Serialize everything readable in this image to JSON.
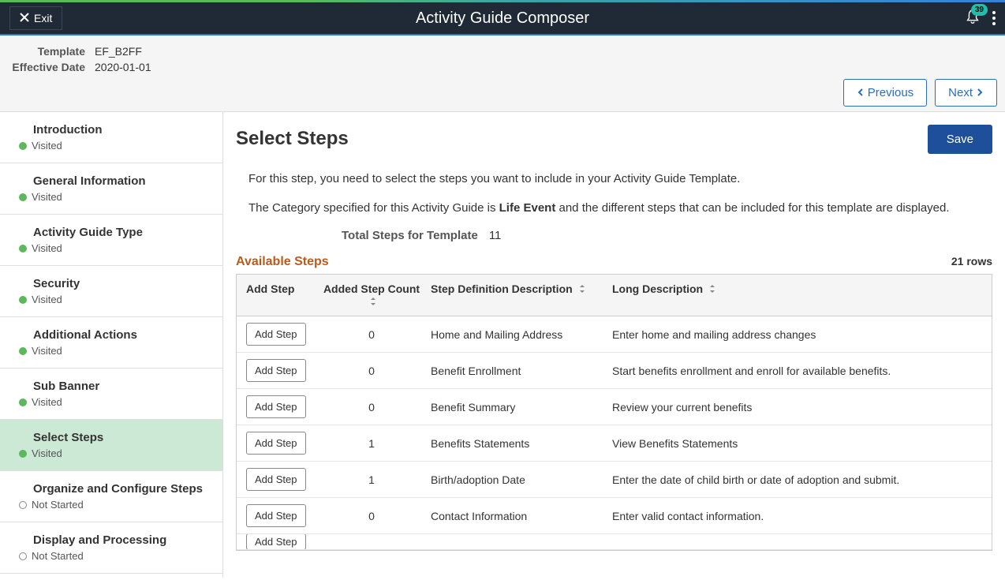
{
  "header": {
    "exit_label": "Exit",
    "title": "Activity Guide Composer",
    "notification_count": "39"
  },
  "meta": {
    "template_label": "Template",
    "template_value": "EF_B2FF",
    "effdate_label": "Effective Date",
    "effdate_value": "2020-01-01",
    "prev_label": "Previous",
    "next_label": "Next"
  },
  "sidebar": {
    "items": [
      {
        "title": "Introduction",
        "status": "Visited",
        "status_class": "visited"
      },
      {
        "title": "General Information",
        "status": "Visited",
        "status_class": "visited"
      },
      {
        "title": "Activity Guide Type",
        "status": "Visited",
        "status_class": "visited"
      },
      {
        "title": "Security",
        "status": "Visited",
        "status_class": "visited"
      },
      {
        "title": "Additional Actions",
        "status": "Visited",
        "status_class": "visited"
      },
      {
        "title": "Sub Banner",
        "status": "Visited",
        "status_class": "visited"
      },
      {
        "title": "Select Steps",
        "status": "Visited",
        "status_class": "visited",
        "active": true
      },
      {
        "title": "Organize and Configure Steps",
        "status": "Not Started",
        "status_class": "notstarted"
      },
      {
        "title": "Display and Processing",
        "status": "Not Started",
        "status_class": "notstarted"
      }
    ]
  },
  "main": {
    "heading": "Select Steps",
    "save_label": "Save",
    "desc_line1": "For this step, you need to select the steps you want to include in your Activity Guide Template.",
    "desc_line2_a": "The Category specified for this Activity Guide is ",
    "desc_line2_bold": "Life Event",
    "desc_line2_b": " and the different steps that can be included for this template are displayed.",
    "total_label": "Total Steps for Template",
    "total_value": "11",
    "section_title": "Available Steps",
    "rows_text": "21 rows",
    "columns": {
      "add": "Add Step",
      "count": "Added Step Count",
      "def": "Step Definition Description",
      "long": "Long Description"
    },
    "add_button_label": "Add Step",
    "rows": [
      {
        "count": "0",
        "def": "Home and Mailing Address",
        "long": "Enter home and mailing address changes"
      },
      {
        "count": "0",
        "def": "Benefit Enrollment",
        "long": "Start benefits enrollment and enroll for available benefits."
      },
      {
        "count": "0",
        "def": "Benefit Summary",
        "long": "Review your current benefits"
      },
      {
        "count": "1",
        "def": "Benefits Statements",
        "long": "View Benefits Statements"
      },
      {
        "count": "1",
        "def": "Birth/adoption Date",
        "long": "Enter the date of child birth or date of adoption and submit."
      },
      {
        "count": "0",
        "def": "Contact Information",
        "long": "Enter valid contact information."
      }
    ]
  }
}
